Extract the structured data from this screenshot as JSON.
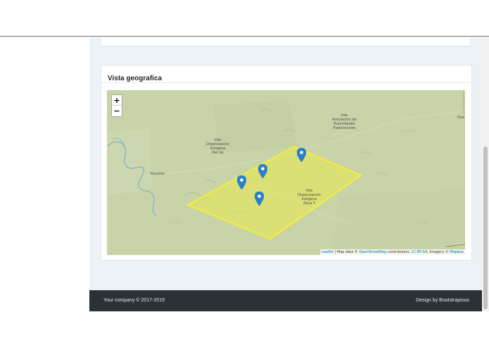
{
  "card": {
    "title": "Vista geografica"
  },
  "map": {
    "zoom_in": "+",
    "zoom_out": "−",
    "labels": [
      {
        "name": "vda-asociacion",
        "text": "Vda\nAsociacion de\nAutoridades\nTradicionales"
      },
      {
        "name": "vda-organizacion-del-va",
        "text": "Vda\nOrganizacion\nIndigena\nDel Va"
      },
      {
        "name": "pucaron",
        "text": "Pucaron"
      },
      {
        "name": "vda-organizacion-zona-y",
        "text": "Vda\nOrganizacion\nIndigena\nZona Y"
      },
      {
        "name": "que",
        "text": "Que"
      }
    ],
    "attribution": {
      "leaflet": "Leaflet",
      "sep1": " | Map data © ",
      "osm": "OpenStreetMap",
      "contrib": " contributors, ",
      "license": "CC-BY-SA",
      "imagery": ", Imagery © ",
      "mapbox": "Mapbox"
    },
    "polygon_color": "#f2ef3a",
    "marker_color": "#2a81cb"
  },
  "footer": {
    "copyright": "Your company © 2017-2019",
    "design": "Design by Bootstrapious"
  }
}
